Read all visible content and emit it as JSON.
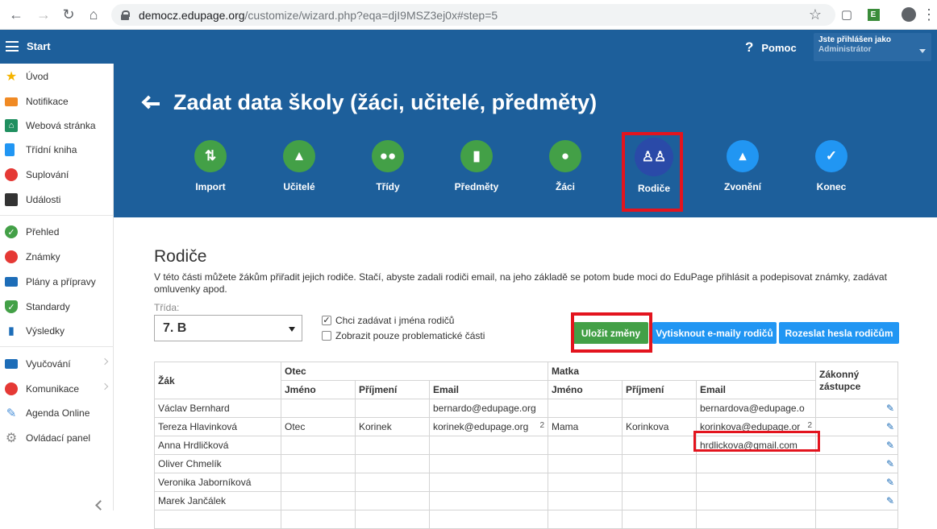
{
  "browser": {
    "url_host": "democz.edupage.org",
    "url_path": "/customize/wizard.php?eqa=djI9MSZ3ej0x#step=5"
  },
  "topbar": {
    "start": "Start",
    "help": "Pomoc",
    "user_line1": "Jste přihlášen jako",
    "user_line2": "Administrátor"
  },
  "sidebar": {
    "items": [
      {
        "label": "Úvod",
        "icon": "star-icon",
        "color": "#f5b400"
      },
      {
        "label": "Notifikace",
        "icon": "envelope-icon",
        "color": "#f08a24"
      },
      {
        "label": "Webová stránka",
        "icon": "home-icon",
        "color": "#1f8f5f"
      },
      {
        "label": "Třídní kniha",
        "icon": "book-icon",
        "color": "#2196f3"
      },
      {
        "label": "Suplování",
        "icon": "substitution-icon",
        "color": "#e53935"
      },
      {
        "label": "Události",
        "icon": "calendar-icon",
        "color": "#333333"
      },
      {
        "label": "Přehled",
        "icon": "check-circle-icon",
        "color": "#43a047"
      },
      {
        "label": "Známky",
        "icon": "grades-icon",
        "color": "#e53935"
      },
      {
        "label": "Plány a přípravy",
        "icon": "briefcase-icon",
        "color": "#1d6db8"
      },
      {
        "label": "Standardy",
        "icon": "shield-check-icon",
        "color": "#43a047"
      },
      {
        "label": "Výsledky",
        "icon": "bar-chart-icon",
        "color": "#1d6db8"
      },
      {
        "label": "Vyučování",
        "icon": "open-book-icon",
        "color": "#1d6db8"
      },
      {
        "label": "Komunikace",
        "icon": "chat-icon",
        "color": "#e53935"
      },
      {
        "label": "Agenda Online",
        "icon": "pencil-icon",
        "color": "#4a90d9"
      },
      {
        "label": "Ovládací panel",
        "icon": "gear-icon",
        "color": "#888888"
      }
    ]
  },
  "hero": {
    "title": "Zadat data školy (žáci, učitelé, předměty)",
    "steps": [
      {
        "label": "Import",
        "icon": "import-icon",
        "state": "done"
      },
      {
        "label": "Učitelé",
        "icon": "graduation-cap-icon",
        "state": "done"
      },
      {
        "label": "Třídy",
        "icon": "group-icon",
        "state": "done"
      },
      {
        "label": "Předměty",
        "icon": "book-icon",
        "state": "done"
      },
      {
        "label": "Žáci",
        "icon": "person-icon",
        "state": "done"
      },
      {
        "label": "Rodiče",
        "icon": "parents-icon",
        "state": "current"
      },
      {
        "label": "Zvonění",
        "icon": "bell-icon",
        "state": "todo"
      },
      {
        "label": "Konec",
        "icon": "check-icon",
        "state": "todo"
      }
    ]
  },
  "main": {
    "section_title": "Rodiče",
    "description": "V této části můžete žákům přiřadit jejich rodiče. Stačí, abyste zadali rodiči email, na jeho základě se potom bude moci do EduPage přihlásit a podepisovat známky, zadávat omluvenky apod.",
    "class_label": "Třída:",
    "class_value": "7. B",
    "checkbox1": {
      "label": "Chci zadávat i jména rodičů",
      "checked": true
    },
    "checkbox2": {
      "label": "Zobrazit pouze problematické části",
      "checked": false
    },
    "save_button": "Uložit změny",
    "print_button": "Vytisknout e-maily rodičů",
    "send_button": "Rozeslat hesla rodičům"
  },
  "table": {
    "headers": {
      "student": "Žák",
      "father": "Otec",
      "mother": "Matka",
      "guardian": "Zákonný zástupce",
      "first_name": "Jméno",
      "last_name": "Příjmení",
      "email": "Email"
    },
    "rows": [
      {
        "student": "Václav Bernhard",
        "f_first": "",
        "f_last": "",
        "f_email": "bernardo@edupage.org",
        "f_cnt": "",
        "m_first": "",
        "m_last": "",
        "m_email": "bernardova@edupage.o",
        "m_cnt": ""
      },
      {
        "student": "Tereza Hlavinková",
        "f_first": "Otec",
        "f_last": "Korinek",
        "f_email": "korinek@edupage.org",
        "f_cnt": "2",
        "m_first": "Mama",
        "m_last": "Korinkova",
        "m_email": "korinkova@edupage.or",
        "m_cnt": "2"
      },
      {
        "student": "Anna Hrdličková",
        "f_first": "",
        "f_last": "",
        "f_email": "",
        "f_cnt": "",
        "m_first": "",
        "m_last": "",
        "m_email": "hrdlickova@gmail.com",
        "m_cnt": ""
      },
      {
        "student": "Oliver Chmelík",
        "f_first": "",
        "f_last": "",
        "f_email": "",
        "f_cnt": "",
        "m_first": "",
        "m_last": "",
        "m_email": "",
        "m_cnt": ""
      },
      {
        "student": "Veronika Jaborníková",
        "f_first": "",
        "f_last": "",
        "f_email": "",
        "f_cnt": "",
        "m_first": "",
        "m_last": "",
        "m_email": "",
        "m_cnt": ""
      },
      {
        "student": "Marek Jančálek",
        "f_first": "",
        "f_last": "",
        "f_email": "",
        "f_cnt": "",
        "m_first": "",
        "m_last": "",
        "m_email": "",
        "m_cnt": ""
      }
    ]
  }
}
